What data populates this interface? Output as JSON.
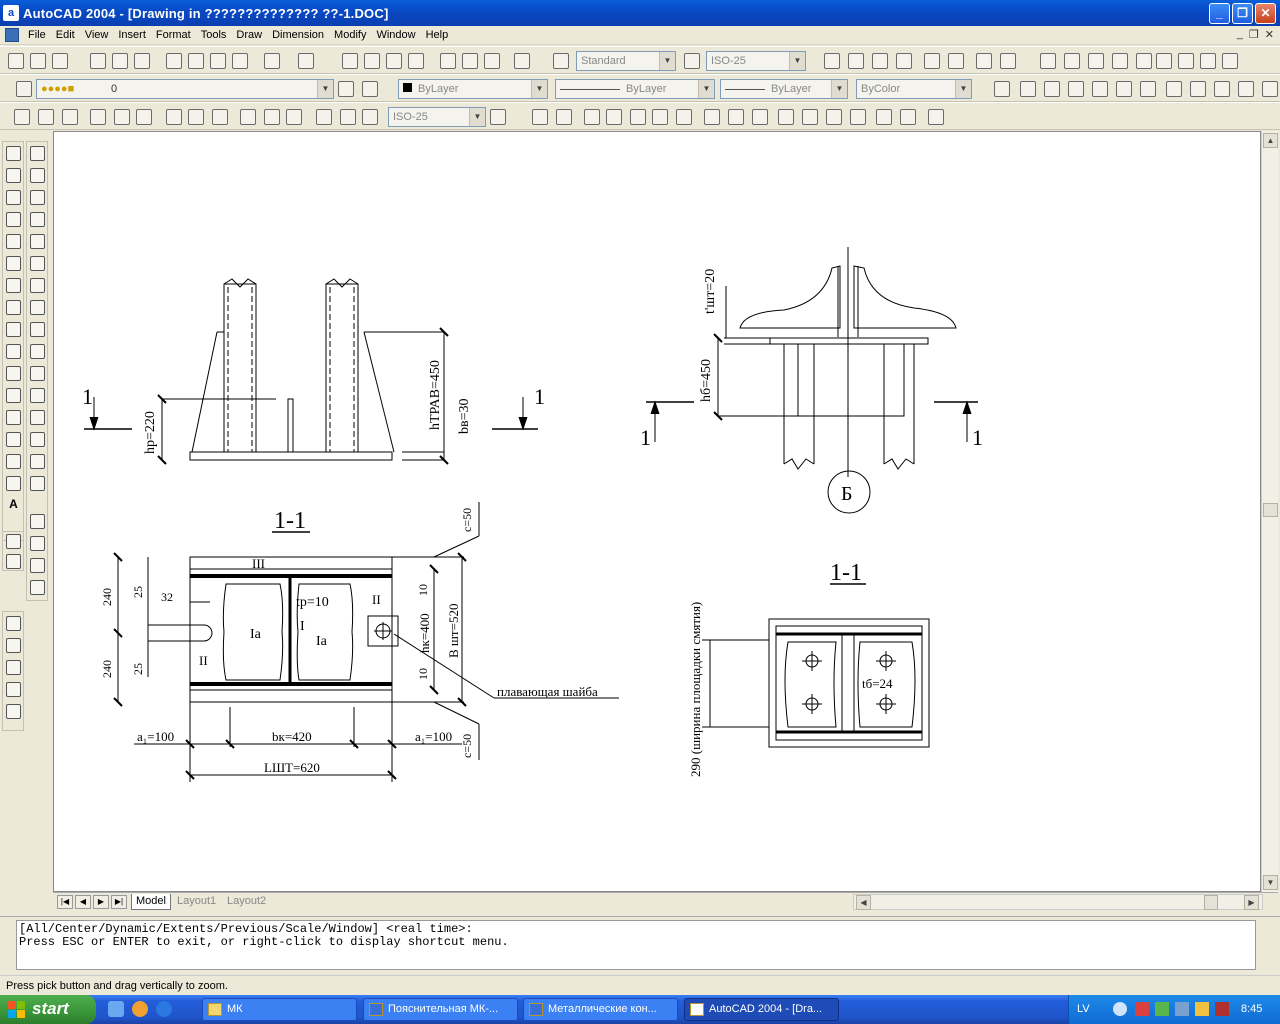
{
  "window": {
    "app_icon": "a",
    "title": "AutoCAD 2004 - [Drawing in ?????????????? ??-1.DOC]",
    "buttons": {
      "minimize": "_",
      "restore": "❐",
      "close": "✕"
    }
  },
  "menu": {
    "items": [
      "File",
      "Edit",
      "View",
      "Insert",
      "Format",
      "Tools",
      "Draw",
      "Dimension",
      "Modify",
      "Window",
      "Help"
    ],
    "mdi_buttons": [
      "_",
      "❐",
      "✕"
    ]
  },
  "toolbars": {
    "text_style": "Standard",
    "dim_style": "ISO-25",
    "layer": "0",
    "color": "ByLayer",
    "linetype": "ByLayer",
    "lineweight": "ByLayer",
    "plot_style": "ByColor",
    "dim_style_2": "ISO-25"
  },
  "drawing": {
    "left_elevation": {
      "section_mark_left": "1",
      "section_mark_right": "1",
      "dim_hp": "hр=220",
      "dim_htrav": "hТРАВ=450",
      "dim_bv": "bв=30"
    },
    "left_plan": {
      "title": "1-1",
      "dim_c_top": "c=50",
      "dim_c_bottom": "c=50",
      "dim_240_top": "240",
      "dim_240_bottom": "240",
      "dim_25_top": "25",
      "dim_25_bottom": "25",
      "dim_32": "32",
      "dim_10_top": "10",
      "dim_10_bottom": "10",
      "label_III": "III",
      "label_II_top": "II",
      "label_II_bottom": "II",
      "label_I": "I",
      "label_Ia_left": "Ia",
      "label_Ia_right": "Ia",
      "dim_tp": "tp=10",
      "dim_hk": "hк=400",
      "dim_bsh": "B шт=520",
      "callout_washer": "плавающая шайба",
      "dim_a1_left": "a₁=100",
      "dim_bk": "bк=420",
      "dim_a1_right": "a₁=100",
      "dim_lsh": "LШТ=620"
    },
    "right_elevation": {
      "dim_tsh": "t'шт=20",
      "dim_hb": "hб=450",
      "section_mark_left": "1",
      "section_mark_right": "1",
      "callout_B": "Б"
    },
    "right_plan": {
      "title": "1-1",
      "dim_tb": "tб=24",
      "dim_290": "290 (ширина площадки смятия)"
    }
  },
  "layout_tabs": [
    "Model",
    "Layout1",
    "Layout2"
  ],
  "command_line": {
    "line1": "[All/Center/Dynamic/Extents/Previous/Scale/Window] <real time>:",
    "line2": "Press ESC or ENTER to exit, or right-click to display shortcut menu."
  },
  "status_bar": "Press pick button and drag vertically to zoom.",
  "taskbar": {
    "start": "start",
    "tasks": [
      "МК",
      "Пояснительная МК-...",
      "Металлические кон...",
      "AutoCAD 2004 - [Dra..."
    ],
    "language": "LV",
    "clock": "8:45"
  }
}
